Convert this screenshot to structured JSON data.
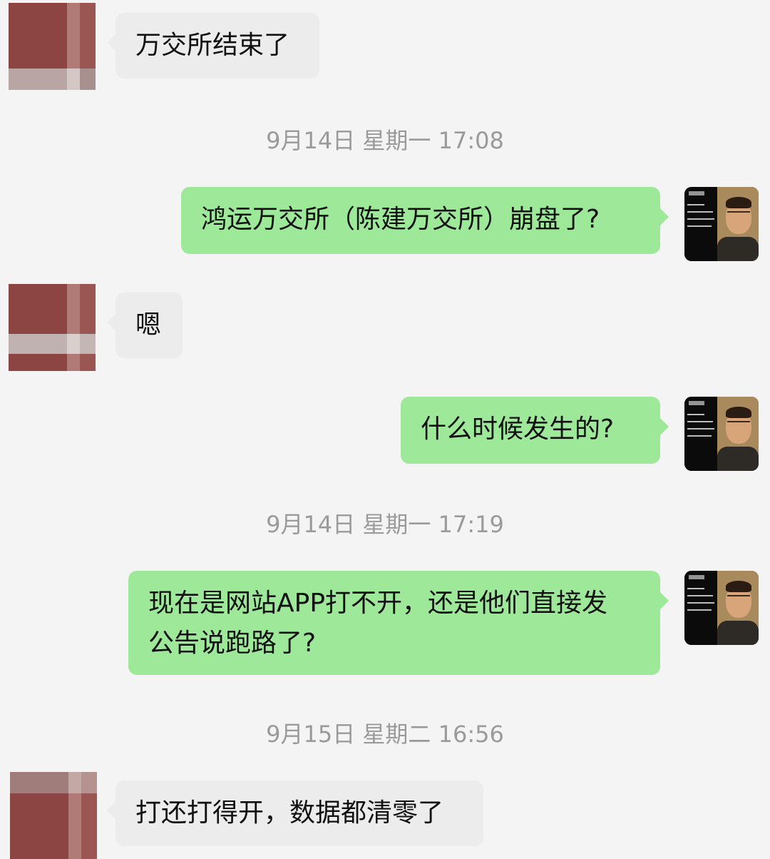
{
  "messages": [
    {
      "side": "left",
      "text": "万交所结束了"
    },
    {
      "timestamp": "9月14日 星期一 17:08"
    },
    {
      "side": "right",
      "text": "鸿运万交所（陈建万交所）崩盘了?"
    },
    {
      "side": "left",
      "text": "嗯"
    },
    {
      "side": "right",
      "text": "什么时候发生的?"
    },
    {
      "timestamp": "9月14日 星期一 17:19"
    },
    {
      "side": "right",
      "text_line1": "现在是网站APP打不开，还是他们直接发",
      "text_line2": "公告说跑路了?"
    },
    {
      "timestamp": "9月15日 星期二 16:56"
    },
    {
      "side": "left",
      "text": "打还打得开，数据都清零了"
    }
  ],
  "colors": {
    "background": "#f4f4f4",
    "bubble_left": "#ececec",
    "bubble_right": "#9ee899",
    "timestamp_text": "#9a9a9a",
    "mosaic_avatar": "#8a4a48"
  },
  "icons": {
    "contact_avatar": "pixelated-avatar",
    "self_avatar": "photo-avatar"
  }
}
